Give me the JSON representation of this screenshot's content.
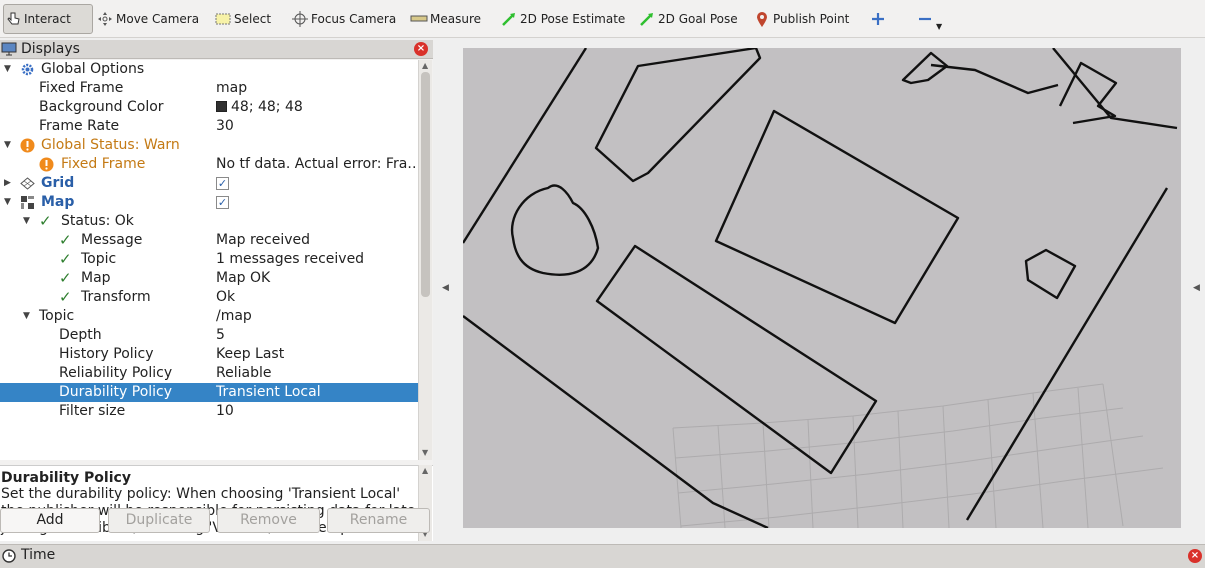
{
  "toolbar": {
    "tools": [
      {
        "label": "Interact",
        "icon": "hand-pointer-icon"
      },
      {
        "label": "Move Camera",
        "icon": "move-camera-icon"
      },
      {
        "label": "Select",
        "icon": "select-box-icon"
      },
      {
        "label": "Focus Camera",
        "icon": "focus-camera-icon"
      },
      {
        "label": "Measure",
        "icon": "ruler-icon"
      },
      {
        "label": "2D Pose Estimate",
        "icon": "green-arrow-icon"
      },
      {
        "label": "2D Goal Pose",
        "icon": "green-arrow-icon"
      },
      {
        "label": "Publish Point",
        "icon": "map-pin-icon"
      }
    ],
    "add_icon": "plus-icon",
    "remove_icon": "minus-icon"
  },
  "displays": {
    "title": "Displays",
    "rows": [
      {
        "name": "Global Options",
        "value": ""
      },
      {
        "name": "Fixed Frame",
        "value": "map"
      },
      {
        "name": "Background Color",
        "value": "48; 48; 48"
      },
      {
        "name": "Frame Rate",
        "value": "30"
      },
      {
        "name": "Global Status: Warn",
        "value": ""
      },
      {
        "name": "Fixed Frame",
        "value": "No tf data.  Actual error: Fra…"
      },
      {
        "name": "Grid",
        "value": ""
      },
      {
        "name": "Map",
        "value": ""
      },
      {
        "name": "Status: Ok",
        "value": ""
      },
      {
        "name": "Message",
        "value": "Map received"
      },
      {
        "name": "Topic",
        "value": "1 messages received"
      },
      {
        "name": "Map",
        "value": "Map OK"
      },
      {
        "name": "Transform",
        "value": "Ok"
      },
      {
        "name": "Topic",
        "value": "/map"
      },
      {
        "name": "Depth",
        "value": "5"
      },
      {
        "name": "History Policy",
        "value": "Keep Last"
      },
      {
        "name": "Reliability Policy",
        "value": "Reliable"
      },
      {
        "name": "Durability Policy",
        "value": "Transient Local"
      },
      {
        "name": "Filter size",
        "value": "10"
      }
    ],
    "checkmark": "✓"
  },
  "description": {
    "title": "Durability Policy",
    "text": "Set the durability policy: When choosing 'Transient Local' the publisher will be responsible for persisting data for late joining subscribers, choosing 'Volatile', no attempt at"
  },
  "buttons": {
    "add": "Add",
    "duplicate": "Duplicate",
    "remove": "Remove",
    "rename": "Rename"
  },
  "time_panel": {
    "title": "Time"
  },
  "colors": {
    "selection": "#3584c6",
    "warn": "#c47a14",
    "link_blue": "#2a5fa8",
    "map_background": "#c2c0c2"
  }
}
